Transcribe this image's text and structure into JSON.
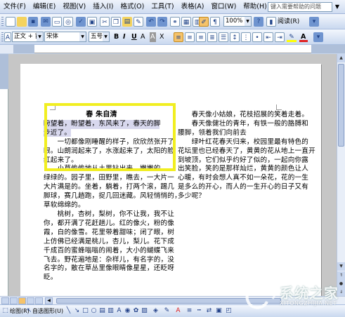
{
  "menu": [
    "文件(F)",
    "编辑(E)",
    "视图(V)",
    "插入(I)",
    "格式(O)",
    "工具(T)",
    "表格(A)",
    "窗口(W)",
    "帮助(H)"
  ],
  "help_box": {
    "placeholder": "键入需要帮助的问题"
  },
  "toolbar1": {
    "zoom": "100%",
    "read_label": "阅读(R)"
  },
  "toolbar2": {
    "style": "正文 + 首行",
    "font": "宋体",
    "size": "五号"
  },
  "document": {
    "title": "春 朱自清",
    "left_lines": [
      "盼望着，盼望着，东风来了，春天的脚",
      "步近了。",
      "　　一切都像刚睡醒的样子，欣欣然张开了",
      "眼。山朗润起来了，水涨起来了，太阳的脸",
      "红起来了。",
      "　　小草偷偷地从土里钻出来，嫩嫩的，",
      "绿绿的。园子里，田野里，瞧去，一大片一",
      "大片满是的。坐着，躺着，打两个滚，踢几",
      "脚球，赛几趟跑，捉几回迷藏。风轻悄悄的，",
      "草软绵绵的。",
      "　　桃树，杏树，梨树，你不让我，我不让",
      "你，都开满了花赶趟儿。红的像火，粉的像",
      "霞，白的像雪。花里带着甜味；闭了眼，树",
      "上仿佛已经满是桃儿，杏儿，梨儿。花下成",
      "千成百的蜜蜂嗡嗡的闹着，大小的蝴蝶飞来",
      "飞去。野花遍地是：杂样儿，有名字的，没",
      "名字的，散在草丛里像眼睛像星星，还眨呀",
      "眨。"
    ],
    "right_lines": [
      "　　春天像小姑娘，花枝招展的笑着走着。",
      "　　春天像健壮的青年，有铁一般的胳膊和",
      "腰脚，领着我们向前去",
      "　　绿叶红花春天归来，校园里最有特色的",
      "花坛里也已经春天了，黄黄的花从地上一直开",
      "到坡顶，它们似乎约好了似的，一起向你露",
      "出笑脸，笑的是那样灿烂，黄黄的颜色让人",
      "心暖，有时会想人真不如一朵花，花的一生",
      "是多么的开心，而人的一生开心的日子又有",
      "多少呢？"
    ]
  },
  "drawbar": {
    "draw_label": "绘图(R)",
    "autoshape_label": "自选图形(U)"
  },
  "watermark": {
    "text": "系统之家",
    "url": "XITONGZHIJIA.NET"
  },
  "colors": {
    "highlight": "#f1ee21",
    "font_color": "#e02020",
    "highlight_marker": "#ffff00"
  }
}
